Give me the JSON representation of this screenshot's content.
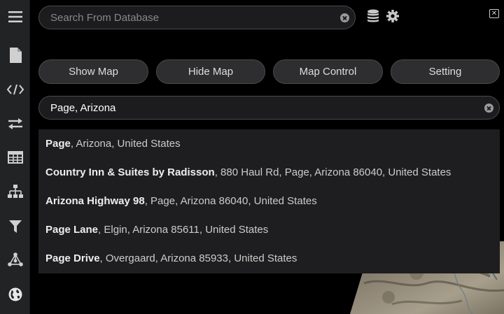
{
  "sidebar": {
    "items": [
      {
        "icon": "menu-icon"
      },
      {
        "icon": "file-icon"
      },
      {
        "icon": "code-icon"
      },
      {
        "icon": "swap-icon"
      },
      {
        "icon": "table-icon"
      },
      {
        "icon": "hierarchy-icon"
      },
      {
        "icon": "filter-icon"
      },
      {
        "icon": "network-icon"
      },
      {
        "icon": "globe-icon"
      }
    ]
  },
  "database_search": {
    "placeholder": "Search From Database",
    "value": ""
  },
  "buttons": {
    "show_map": "Show Map",
    "hide_map": "Hide Map",
    "map_control": "Map Control",
    "setting": "Setting"
  },
  "location_search": {
    "value": "Page, Arizona"
  },
  "results": [
    {
      "bold": "Page",
      "rest": ", Arizona, United States"
    },
    {
      "bold": "Country Inn & Suites by Radisson",
      "rest": ", 880 Haul Rd, Page, Arizona 86040, United States"
    },
    {
      "bold": "Arizona Highway 98",
      "rest": ", Page, Arizona 86040, United States"
    },
    {
      "bold": "Page Lane",
      "rest": ", Elgin, Arizona 85611, United States"
    },
    {
      "bold": "Page Drive",
      "rest": ", Overgaard, Arizona 85933, United States"
    }
  ],
  "colors": {
    "background": "#000000",
    "sidebar": "#222325",
    "button": "#2e2e30",
    "dropdown": "#1e1e20"
  }
}
